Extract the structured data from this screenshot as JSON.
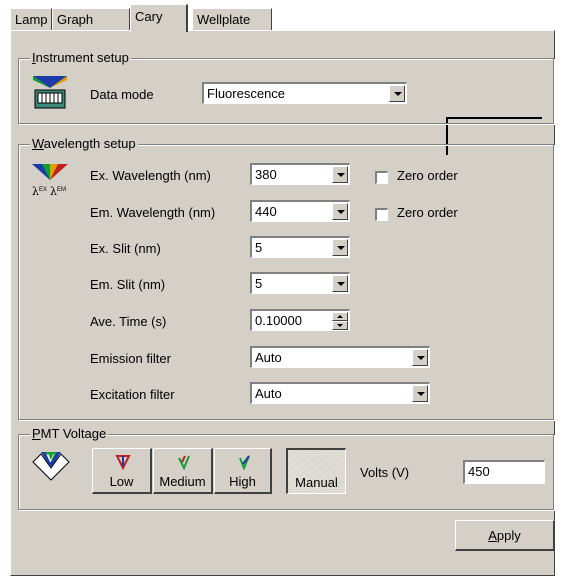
{
  "tabs": [
    "Lamp",
    "Graph",
    "Cary",
    "Wellplate"
  ],
  "active_tab": "Cary",
  "instrument_setup": {
    "title": "Instrument setup",
    "title_accel": "I",
    "title_rest": "nstrument setup",
    "data_mode_label": "Data mode",
    "data_mode_value": "Fluorescence"
  },
  "wavelength_setup": {
    "title": "Wavelength setup",
    "title_accel": "W",
    "title_rest": "avelength setup",
    "icon_caption": "λex λem",
    "rows": [
      {
        "label": "Ex. Wavelength (nm)",
        "value": "380"
      },
      {
        "label": "Em. Wavelength (nm)",
        "value": "440"
      },
      {
        "label": "Ex. Slit (nm)",
        "value": "5"
      },
      {
        "label": "Em. Slit (nm)",
        "value": "5"
      },
      {
        "label": "Ave. Time (s)",
        "value": "0.10000"
      },
      {
        "label": "Emission filter",
        "value": "Auto"
      },
      {
        "label": "Excitation filter",
        "value": "Auto"
      }
    ],
    "zero_order_ex": {
      "label": "Zero order",
      "checked": false
    },
    "zero_order_em": {
      "label": "Zero order",
      "checked": false
    }
  },
  "pmt_voltage": {
    "title": "PMT Voltage",
    "title_accel": "P",
    "title_rest": "MT Voltage",
    "buttons": [
      "Low",
      "Medium",
      "High",
      "Manual"
    ],
    "selected": "Manual",
    "volts_label": "Volts (V)",
    "volts_value": "450"
  },
  "apply": {
    "label": "Apply",
    "accel": "A",
    "rest": "pply"
  },
  "colors": {
    "face": "#d4d0c8",
    "shadow": "#808080",
    "dark": "#404040"
  },
  "icons": [
    "instrument-icon",
    "wavelength-icon",
    "pmt-icon",
    "low-voltage-icon",
    "medium-voltage-icon",
    "high-voltage-icon"
  ]
}
